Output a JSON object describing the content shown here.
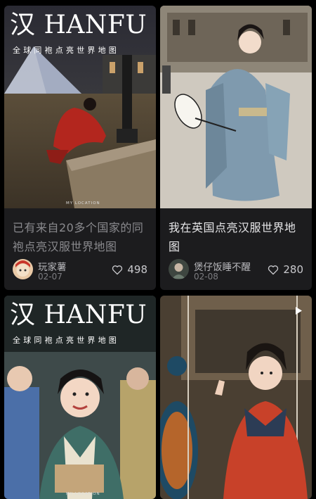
{
  "feed": {
    "cards": [
      {
        "overlay_title": "汉 HANFU 服",
        "overlay_subtitle": "全球同袍点亮世界地图",
        "location_tag": "MY LOCATION",
        "title": "已有来自20多个国家的同袍点亮汉服世界地图",
        "author": "玩家薯",
        "date": "02-07",
        "likes": "498"
      },
      {
        "title": "我在英国点亮汉服世界地图",
        "author": "煲仔饭睡不醒",
        "date": "02-08",
        "likes": "280"
      },
      {
        "overlay_title": "汉 HANFU 服",
        "overlay_subtitle": "全球同袍点亮世界地图",
        "location_tag": "MY LOCATION"
      },
      {}
    ]
  },
  "icons": {
    "like": "heart-outline-icon",
    "video": "play-icon"
  }
}
